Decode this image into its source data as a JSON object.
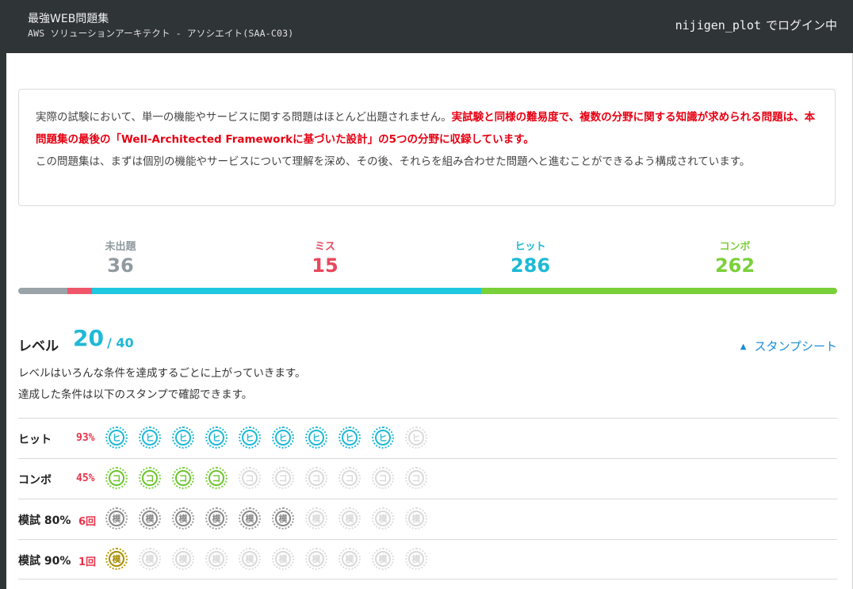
{
  "header": {
    "title": "最強WEB問題集",
    "subtitle": "AWS ソリューションアーキテクト - アソシエイト(SAA-C03)",
    "username": "nijigen_plot",
    "login_suffix": "でログイン中"
  },
  "notice": {
    "text1": "実際の試験において、単一の機能やサービスに関する問題はほとんど出題されません。",
    "text2_red": "実試験と同様の難易度で、複数の分野に関する知識が求められる問題は、本問題集の最後の「Well-Architected Frameworkに基づいた設計」の5つの分野に収録しています。",
    "text3": "この問題集は、まずは個別の機能やサービスについて理解を深め、その後、それらを組み合わせた問題へと進むことができるよう構成されています。"
  },
  "stats": [
    {
      "label": "未出題",
      "value": "36",
      "color": "#909aa0"
    },
    {
      "label": "ミス",
      "value": "15",
      "color": "#e8485c"
    },
    {
      "label": "ヒット",
      "value": "286",
      "color": "#1eb9d6"
    },
    {
      "label": "コンボ",
      "value": "262",
      "color": "#7ad03a"
    }
  ],
  "progress": [
    {
      "name": "unanswered",
      "fraction": 0.06,
      "color": "#9aa3a7"
    },
    {
      "name": "miss",
      "fraction": 0.03,
      "color": "#f0566a"
    },
    {
      "name": "hit",
      "fraction": 0.475,
      "color": "#1ec8e0"
    },
    {
      "name": "combo",
      "fraction": 0.435,
      "color": "#7ad03a"
    }
  ],
  "level": {
    "label": "レベル",
    "current": "20",
    "max": "/ 40",
    "stamp_sheet_link": "スタンプシート",
    "desc_line1": "レベルはいろんな条件を達成するごとに上がっていきます。",
    "desc_line2": "達成した条件は以下のスタンプで確認できます。"
  },
  "stamp_rows": [
    {
      "name": "ヒット",
      "stat": "93%",
      "glyph": "ヒ",
      "earned": 9,
      "total": 10,
      "style": "hit"
    },
    {
      "name": "コンボ",
      "stat": "45%",
      "glyph": "コ",
      "earned": 4,
      "total": 10,
      "style": "combo"
    },
    {
      "name": "模試 80%",
      "stat": "6回",
      "glyph": "模",
      "earned": 6,
      "total": 10,
      "style": "mock"
    },
    {
      "name": "模試 90%",
      "stat": "1回",
      "glyph": "模",
      "earned": 1,
      "total": 10,
      "style": "gold"
    }
  ]
}
